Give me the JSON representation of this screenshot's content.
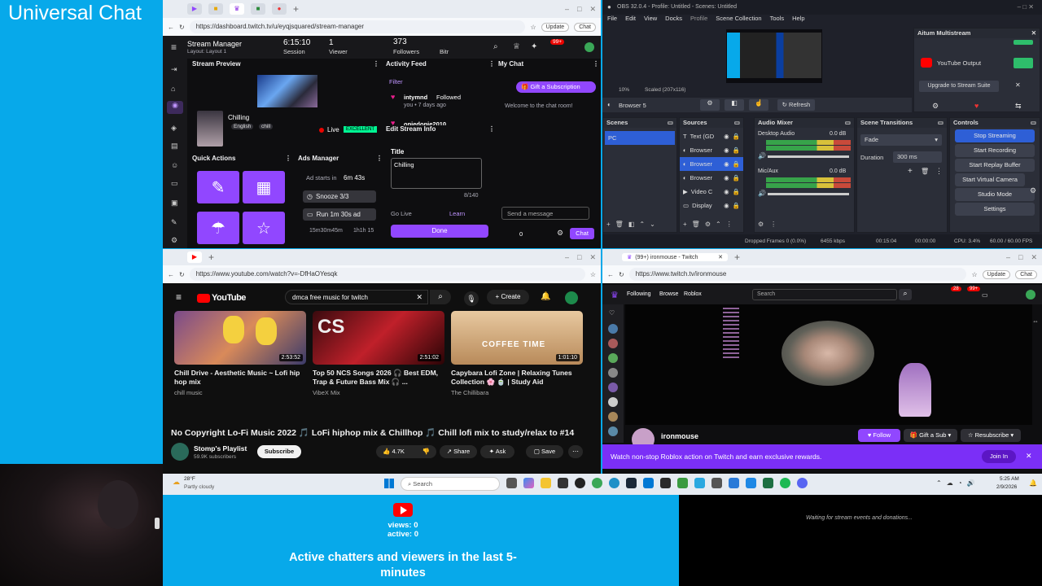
{
  "overlay": {
    "title": "Universal Chat",
    "stats": {
      "views": "views: 0",
      "active": "active: 0"
    },
    "caption": "Active chatters and viewers in the last 5-minutes",
    "alerts_text": "Waiting for stream events and donations..."
  },
  "twitch_manager": {
    "url": "https://dashboard.twitch.tv/u/eyqjsquared/stream-manager",
    "update_label": "Update",
    "chat_label": "Chat",
    "header": {
      "title": "Stream Manager",
      "layout": "Layout: Layout 1",
      "session_value": "6:15:10",
      "session_label": "Session",
      "viewer_value": "1",
      "viewer_label": "Viewer",
      "followers_value": "373",
      "followers_label": "Followers",
      "bitrate_label": "Bitr",
      "notif_badge": "99+"
    },
    "preview": {
      "title": "Stream Preview",
      "stream_title": "Chilling",
      "tag_lang": "English",
      "tag_chill": "chill",
      "live": "Live",
      "quality": "EXCELLENT"
    },
    "quick_actions": {
      "title": "Quick Actions"
    },
    "ads": {
      "title": "Ads Manager",
      "starts_in_label": "Ad starts in",
      "starts_in_value": "6m 43s",
      "snooze": "Snooze 3/3",
      "run": "Run 1m 30s ad",
      "footer_left": "15m30m45m",
      "footer_right": "1h1h 15"
    },
    "activity": {
      "title": "Activity Feed",
      "filter": "Filter",
      "item1_user": "intymnd",
      "item1_action": "Followed",
      "item1_time": "you • 7 days ago",
      "item2_user": "opiedopie2010"
    },
    "edit_info": {
      "title": "Edit Stream Info",
      "field_label": "Title",
      "field_value": "Chilling",
      "counter": "8/140",
      "golive": "Go Live",
      "learn": "Learn",
      "done": "Done"
    },
    "chat": {
      "title": "My Chat",
      "gift": "Gift a Subscription",
      "welcome": "Welcome to the chat room!",
      "placeholder": "Send a message",
      "points": "0",
      "button": "Chat"
    }
  },
  "obs": {
    "title": "OBS 32.0.4 - Profile: Untitled - Scenes: Untitled",
    "menu": [
      "File",
      "Edit",
      "View",
      "Docks",
      "Profile",
      "Scene Collection",
      "Tools",
      "Help"
    ],
    "multistream": {
      "title": "Aitum Multistream",
      "output": "YouTube Output",
      "upgrade": "Upgrade to Stream Suite"
    },
    "zoom": "10%",
    "scaled": "Scaled (207x116)",
    "source_name": "Browser 5",
    "refresh": "Refresh",
    "scenes": {
      "title": "Scenes",
      "items": [
        "PC"
      ]
    },
    "sources": {
      "title": "Sources",
      "items": [
        "Text (GD",
        "Browser",
        "Browser",
        "Browser",
        "Video C",
        "Display"
      ]
    },
    "mixer": {
      "title": "Audio Mixer",
      "ch1": "Desktop Audio",
      "ch1_db": "0.0 dB",
      "ch2": "Mic/Aux",
      "ch2_db": "0.0 dB"
    },
    "transitions": {
      "title": "Scene Transitions",
      "type": "Fade",
      "duration_label": "Duration",
      "duration_value": "300 ms"
    },
    "controls": {
      "title": "Controls",
      "buttons": [
        "Stop Streaming",
        "Start Recording",
        "Start Replay Buffer",
        "Start Virtual Camera",
        "Studio Mode",
        "Settings"
      ]
    },
    "status": {
      "dropped": "Dropped Frames 0 (0.0%)",
      "bitrate": "6455 kbps",
      "stream_time": "00:15:04",
      "rec_time": "00:00:00",
      "cpu": "CPU: 3.4%",
      "fps": "60.00 / 60.00 FPS"
    }
  },
  "youtube": {
    "url": "https://www.youtube.com/watch?v=-DfHaOYesqk",
    "search_value": "dmca free music for twitch",
    "create": "Create",
    "logo": "YouTube",
    "videos": [
      {
        "title": "Chill Drive - Aesthetic Music ~ Lofi hip hop mix",
        "channel": "chill music",
        "duration": "2:53:52"
      },
      {
        "title": "Top 50 NCS Songs 2026 🎧 Best EDM, Trap & Future Bass Mix 🎧 ...",
        "channel": "VibeX Mix",
        "duration": "2:51:02"
      },
      {
        "title": "Capybara Lofi Zone | Relaxing Tunes Collection 🌸 🍵 | Study Aid",
        "channel": "The Chillibara",
        "duration": "1:01:10",
        "thumb_text": "COFFEE TIME"
      }
    ],
    "main_title": "No Copyright Lo-Fi Music 2022 🎵 LoFi hiphop mix & Chillhop 🎵 Chill lofi mix to study/relax to #14",
    "channel": "Stomp's Playlist",
    "subs": "59.9K subscribers",
    "subscribe": "Subscribe",
    "likes": "4.7K",
    "share": "Share",
    "ask": "Ask",
    "save": "Save"
  },
  "twitch_viewer": {
    "tab": "(99+) ironmouse - Twitch",
    "url": "https://www.twitch.tv/ironmouse",
    "nav": [
      "Following",
      "Browse",
      "Roblox"
    ],
    "search_placeholder": "Search",
    "badge1": "28",
    "badge2": "99+",
    "streamer": "ironmouse",
    "follow": "Follow",
    "gift": "Gift a Sub",
    "resub": "Resubscribe",
    "banner": "Watch non-stop Roblox action on Twitch and earn exclusive rewards.",
    "join": "Join In"
  },
  "taskbar": {
    "temp": "28°F",
    "weather": "Partly cloudy",
    "search": "Search",
    "time": "5:25 AM",
    "date": "2/9/2026"
  },
  "colors": {
    "twitch_purple": "#9147ff",
    "youtube_red": "#ff0000",
    "overlay_blue": "#07a9ea",
    "obs_stop_blue": "#2e5fd6"
  }
}
